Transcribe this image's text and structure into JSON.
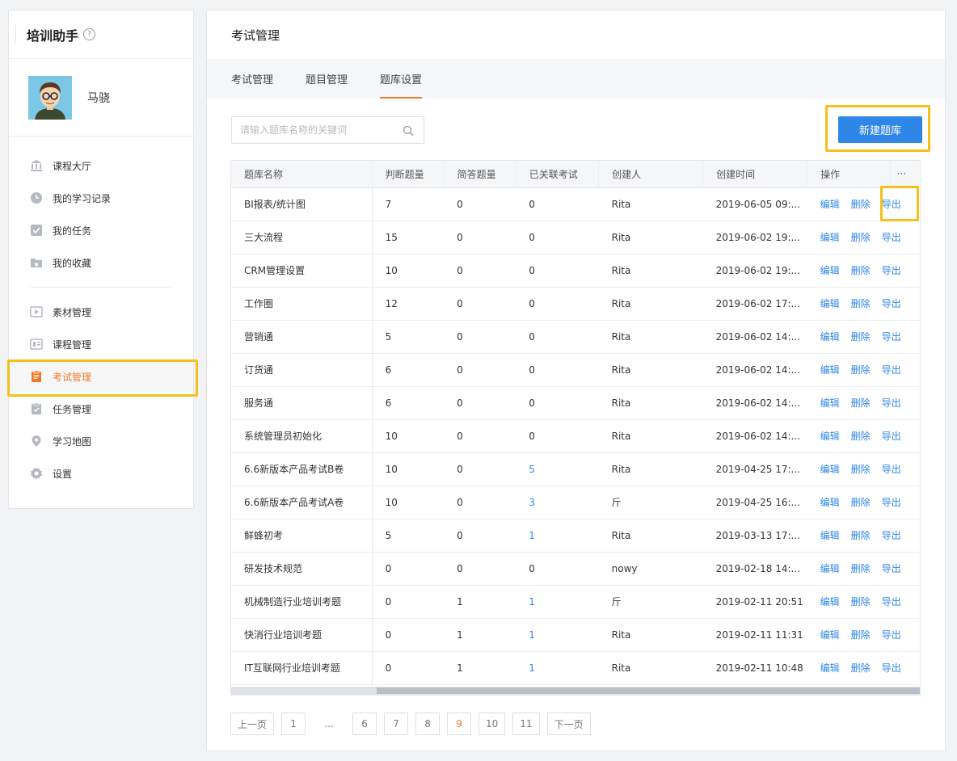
{
  "app": {
    "title": "培训助手",
    "help_icon": "?"
  },
  "user": {
    "name": "马骁"
  },
  "menu": {
    "primary": [
      {
        "label": "课程大厅",
        "icon": "bank-icon"
      },
      {
        "label": "我的学习记录",
        "icon": "clock-icon"
      },
      {
        "label": "我的任务",
        "icon": "check-icon"
      },
      {
        "label": "我的收藏",
        "icon": "star-folder-icon"
      }
    ],
    "secondary": [
      {
        "label": "素材管理",
        "icon": "play-icon"
      },
      {
        "label": "课程管理",
        "icon": "book-icon"
      },
      {
        "label": "考试管理",
        "icon": "clipboard-icon",
        "active": true
      },
      {
        "label": "任务管理",
        "icon": "task-icon"
      },
      {
        "label": "学习地图",
        "icon": "pin-icon"
      },
      {
        "label": "设置",
        "icon": "gear-icon"
      }
    ]
  },
  "main": {
    "title": "考试管理",
    "tabs": [
      {
        "label": "考试管理"
      },
      {
        "label": "题目管理"
      },
      {
        "label": "题库设置",
        "active": true
      }
    ],
    "search": {
      "placeholder": "请输入题库名称的关键词",
      "value": ""
    },
    "new_button": "新建题库"
  },
  "table": {
    "columns": [
      "题库名称",
      "判断题量",
      "简答题量",
      "已关联考试",
      "创建人",
      "创建时间",
      "操作"
    ],
    "more": "···",
    "ops": [
      "编辑",
      "删除",
      "导出"
    ],
    "rows": [
      {
        "name": "BI报表/统计图",
        "judge": "7",
        "essay": "0",
        "linked": "0",
        "creator": "Rita",
        "time": "2019-06-05 09:..."
      },
      {
        "name": "三大流程",
        "judge": "15",
        "essay": "0",
        "linked": "0",
        "creator": "Rita",
        "time": "2019-06-02 19:..."
      },
      {
        "name": "CRM管理设置",
        "judge": "10",
        "essay": "0",
        "linked": "0",
        "creator": "Rita",
        "time": "2019-06-02 19:..."
      },
      {
        "name": "工作圈",
        "judge": "12",
        "essay": "0",
        "linked": "0",
        "creator": "Rita",
        "time": "2019-06-02 17:..."
      },
      {
        "name": "营销通",
        "judge": "5",
        "essay": "0",
        "linked": "0",
        "creator": "Rita",
        "time": "2019-06-02 14:..."
      },
      {
        "name": "订货通",
        "judge": "6",
        "essay": "0",
        "linked": "0",
        "creator": "Rita",
        "time": "2019-06-02 14:..."
      },
      {
        "name": "服务通",
        "judge": "6",
        "essay": "0",
        "linked": "0",
        "creator": "Rita",
        "time": "2019-06-02 14:..."
      },
      {
        "name": "系统管理员初始化",
        "judge": "10",
        "essay": "0",
        "linked": "0",
        "creator": "Rita",
        "time": "2019-06-02 14:..."
      },
      {
        "name": "6.6新版本产品考试B卷",
        "judge": "10",
        "essay": "0",
        "linked": "5",
        "creator": "Rita",
        "time": "2019-04-25 17:..."
      },
      {
        "name": "6.6新版本产品考试A卷",
        "judge": "10",
        "essay": "0",
        "linked": "3",
        "creator": "斤",
        "time": "2019-04-25 16:..."
      },
      {
        "name": "鲜蜂初考",
        "judge": "5",
        "essay": "0",
        "linked": "1",
        "creator": "Rita",
        "time": "2019-03-13 17:..."
      },
      {
        "name": "研发技术规范",
        "judge": "0",
        "essay": "0",
        "linked": "0",
        "creator": "nowy",
        "time": "2019-02-18 14:..."
      },
      {
        "name": "机械制造行业培训考题",
        "judge": "0",
        "essay": "1",
        "linked": "1",
        "creator": "斤",
        "time": "2019-02-11 20:51"
      },
      {
        "name": "快消行业培训考题",
        "judge": "0",
        "essay": "1",
        "linked": "1",
        "creator": "Rita",
        "time": "2019-02-11 11:31"
      },
      {
        "name": "IT互联网行业培训考题",
        "judge": "0",
        "essay": "1",
        "linked": "1",
        "creator": "Rita",
        "time": "2019-02-11 10:48"
      }
    ]
  },
  "pagination": {
    "prev": "上一页",
    "next": "下一页",
    "pages": [
      "1",
      "...",
      "6",
      "7",
      "8",
      "9",
      "10",
      "11"
    ],
    "current": "9"
  },
  "colors": {
    "accent": "#f07a2a",
    "primary": "#2f86e9",
    "highlight": "#f5c01b"
  }
}
